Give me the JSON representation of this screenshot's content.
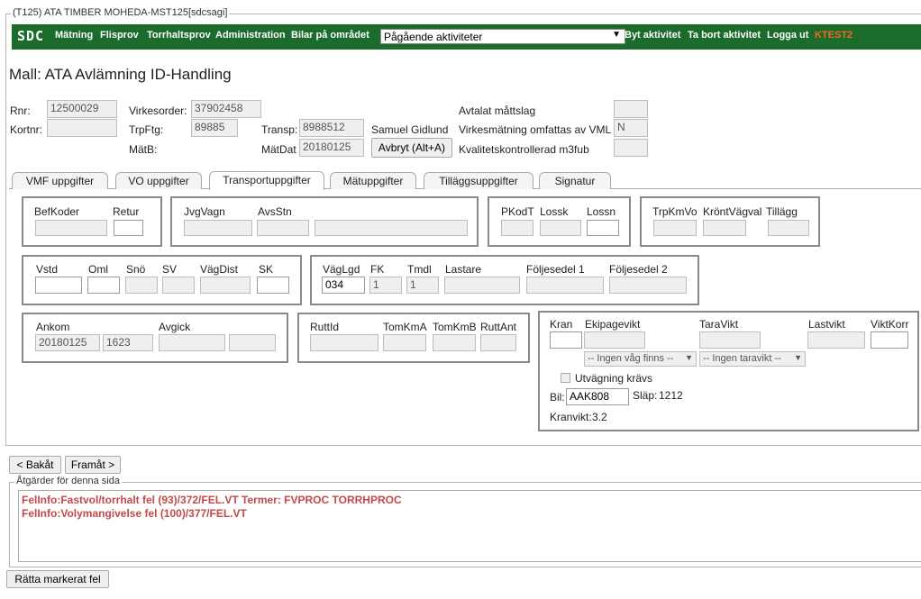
{
  "window": {
    "title": "(T125) ATA TIMBER MOHEDA-MST125[sdcsagi]"
  },
  "nav": {
    "logo": "SDC",
    "items": [
      "Mätning",
      "Flisprov",
      "Torrhaltsprov",
      "Administration",
      "Bilar på området"
    ],
    "activity_select": "Pågående aktiviteter",
    "actions": [
      "Byt aktivitet",
      "Ta bort aktivitet",
      "Logga ut"
    ],
    "user": "KTEST2",
    "user_color": "#f26a22"
  },
  "page_title": "Mall: ATA Avlämning ID-Handling",
  "header": {
    "rnr_label": "Rnr:",
    "rnr": "12500029",
    "virkesorder_label": "Virkesorder:",
    "virkesorder": "37902458",
    "avtalat_label": "Avtalat måttslag",
    "avtalat": "",
    "kortnr_label": "Kortnr:",
    "kortnr": "",
    "trpftg_label": "TrpFtg:",
    "trpftg": "89885",
    "transp_label": "Transp:",
    "transp": "8988512",
    "driver": "Samuel Gidlund",
    "vml_label": "Virkesmätning omfattas av VML",
    "vml": "N",
    "matb_label": "MätB:",
    "matdat_label": "MätDat",
    "matdat": "20180125",
    "abort_button": "Avbryt (Alt+A)",
    "kval_label": "Kvalitetskontrollerad m3fub",
    "kval": ""
  },
  "tabs": [
    "VMF uppgifter",
    "VO uppgifter",
    "Transportuppgifter",
    "Mätuppgifter",
    "Tilläggsuppgifter",
    "Signatur"
  ],
  "active_tab": "Transportuppgifter",
  "transport": {
    "befkoder": "BefKoder",
    "retur": "Retur",
    "jvgvagn": "JvgVagn",
    "avsstn": "AvsStn",
    "pkodt": "PKodT",
    "lossk": "Lossk",
    "lossn": "Lossn",
    "trpkmvo": "TrpKmVo",
    "krontvagval": "KröntVägval",
    "tillagg": "Tillägg",
    "vstd": "Vstd",
    "oml": "Oml",
    "sno": "Snö",
    "sv": "SV",
    "vagdist": "VägDist",
    "sk": "SK",
    "vaglgd": "VägLgd",
    "vaglgd_value": "034",
    "fk": "FK",
    "fk_value": "1",
    "tmdl": "Tmdl",
    "tmdl_value": "1",
    "lastare": "Lastare",
    "foljesedel1": "Följesedel 1",
    "foljesedel2": "Följesedel 2",
    "ankom": "Ankom",
    "ankom_date": "20180125",
    "ankom_time": "1623",
    "avgick": "Avgick",
    "ruttid": "RuttId",
    "tomkma": "TomKmA",
    "tomkmb": "TomKmB",
    "ruttant": "RuttAnt",
    "kran": "Kran",
    "ekipagevikt": "Ekipagevikt",
    "taravikt": "TaraVikt",
    "lastvikt": "Lastvikt",
    "viktkorr": "ViktKorr",
    "vag_select": "-- Ingen våg finns --",
    "tara_select": "-- Ingen taravikt --",
    "utvagning_label": "Utvägning krävs",
    "bil_label": "Bil:",
    "bil": "AAK808",
    "slap_label": "Släp:",
    "slap": "1212",
    "kranvikt_label": "Kranvikt:",
    "kranvikt": "3.2"
  },
  "nav_buttons": {
    "back": "< Bakåt",
    "forward": "Framåt >"
  },
  "actions_section": {
    "legend": "Åtgärder för denna sida",
    "errors": [
      "FelInfo:Fastvol/torrhalt fel (93)/372/FEL.VT Termer: FVPROC TORRHPROC",
      "FelInfo:Volymangivelse fel (100)/377/FEL.VT"
    ],
    "error_color": "#c24a4a"
  },
  "fix_button": "Rätta markerat fel"
}
